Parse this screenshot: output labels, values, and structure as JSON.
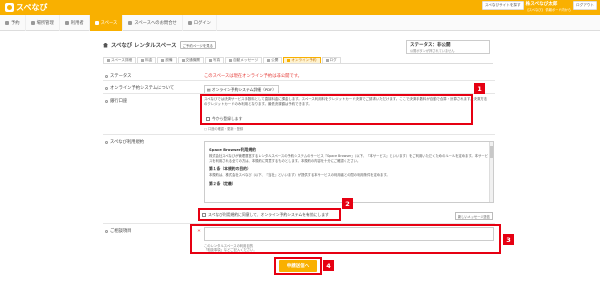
{
  "app": {
    "logo_text": "スペなび"
  },
  "topbar": {
    "search_btn": "スペなびサイトを探す",
    "user_name": "株スペなび太郎",
    "logout_btn": "ログアウト",
    "sub_links": "【スペなび】 情報ボード内から"
  },
  "nav": {
    "items": [
      {
        "label": "予約"
      },
      {
        "label": "場所管理"
      },
      {
        "label": "利用者"
      },
      {
        "label": "スペース"
      },
      {
        "label": "スペースへのお問合せ"
      },
      {
        "label": "ログイン"
      }
    ]
  },
  "page": {
    "title": "スペなび レンタルスペース",
    "title_btn": "ご予約ページを見る",
    "status_line1": "ステータス：非公開",
    "status_line2": "公開ボタンが押されていません"
  },
  "tabs": [
    {
      "label": "スペース詳細"
    },
    {
      "label": "料金"
    },
    {
      "label": "設備"
    },
    {
      "label": "交通機関"
    },
    {
      "label": "写真"
    },
    {
      "label": "自動メッセージ"
    },
    {
      "label": "公開"
    },
    {
      "label": "オンライン予約"
    },
    {
      "label": "ログ"
    }
  ],
  "form": {
    "status_label": "ステータス",
    "status_value": "このスペースは現在オンライン予約は非公開です。",
    "about_label": "オンライン予約システムについて",
    "pdf_link": "オンライン予約システム詳細（PDF）",
    "payment_label": "銀行口座",
    "payment_text": "スペなびでは決済サービス手数料として直接料金に課金します。スペース利用料をクレジットカード決済でご請求いただけます。ここで決済手数料が自動で合算・計算されます。決済方法のクレジットカードのみ利用となります。最低決済額は予約できます。",
    "payment_checkbox": "今から登録します",
    "confirm_link": "口座の確認・更新・登録",
    "terms_label": "スペなび利用規約",
    "terms": [
      {
        "head": "Space Browser利用規約",
        "body": "株式会社スペなびが管理運営するレンタルスペースの予約システムのサービス『Space Browser』（以下、『本サービス』といいます）をご利用いただくためのルールを定めます。本サービスを利用される全ての方は、本規約に同意するものとします。本規約の内容を十分にご確認ください。"
      },
      {
        "head": "第１条（本規約の目的）",
        "body": "本規約は、株式会社スペなび（以下、『当社』といいます）が提供する本サービスの利用者との間の利用条件を定めます。"
      },
      {
        "head": "第２条（定義）",
        "body": ""
      }
    ],
    "agree_checkbox": "スペなび利用規約に同意して、オンライン予約システムを有効にします",
    "msg_button": "新しいメッセージ送信",
    "inquiry_label": "ご相談項目",
    "req_mark": "＊",
    "hint": "このレンタルスペースの利用目的\n「相談事項」などご記入ください。",
    "submit": "申請送信へ"
  },
  "badges": [
    "1",
    "2",
    "3",
    "4"
  ]
}
